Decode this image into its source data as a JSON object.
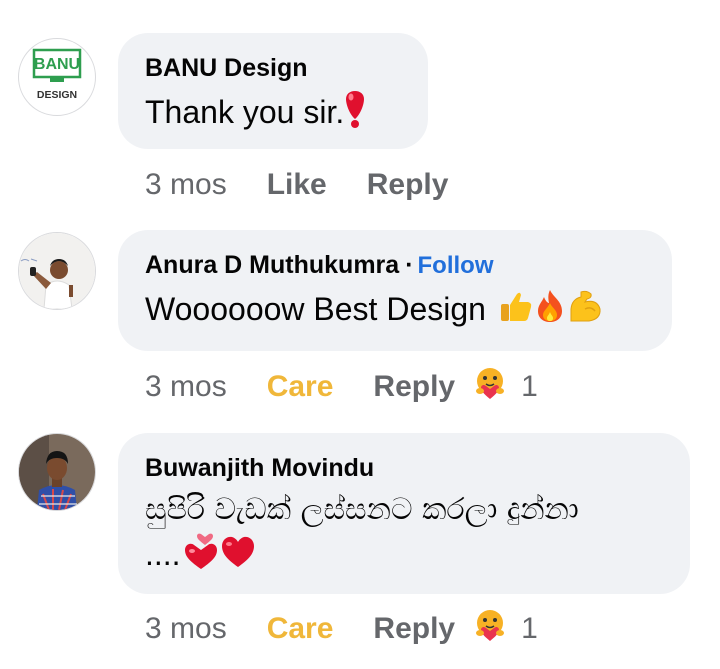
{
  "comments": [
    {
      "author": "BANU Design",
      "avatar_logo_text": "BANU",
      "avatar_sub_text": "DESIGN",
      "text": "Thank you sir.",
      "emojis": [
        "heavy-exclamation-icon"
      ],
      "time": "3 mos",
      "reaction_label": "Like",
      "reply_label": "Reply"
    },
    {
      "author": "Anura D Muthukumra",
      "separator": "·",
      "follow_label": "Follow",
      "text": "Woooooow Best Design",
      "emojis": [
        "thumbs-up-icon",
        "fire-icon",
        "flexed-biceps-icon"
      ],
      "time": "3 mos",
      "reaction_label": "Care",
      "reply_label": "Reply",
      "reaction_icon": "care-reaction-icon",
      "reaction_count": "1"
    },
    {
      "author": "Buwanjith Movindu",
      "text_line1": "සුපිරි වැඩක් ලස්සනට කරලා දුන්නා",
      "text_line2": "....",
      "emojis": [
        "heart-exclamation-icon",
        "red-heart-icon"
      ],
      "time": "3 mos",
      "reaction_label": "Care",
      "reply_label": "Reply",
      "reaction_icon": "care-reaction-icon",
      "reaction_count": "1"
    }
  ],
  "colors": {
    "bubble": "#f0f2f5",
    "follow": "#216fdb",
    "care": "#f0b73a",
    "meta": "#65676b",
    "logo_green": "#2e9e4f"
  }
}
